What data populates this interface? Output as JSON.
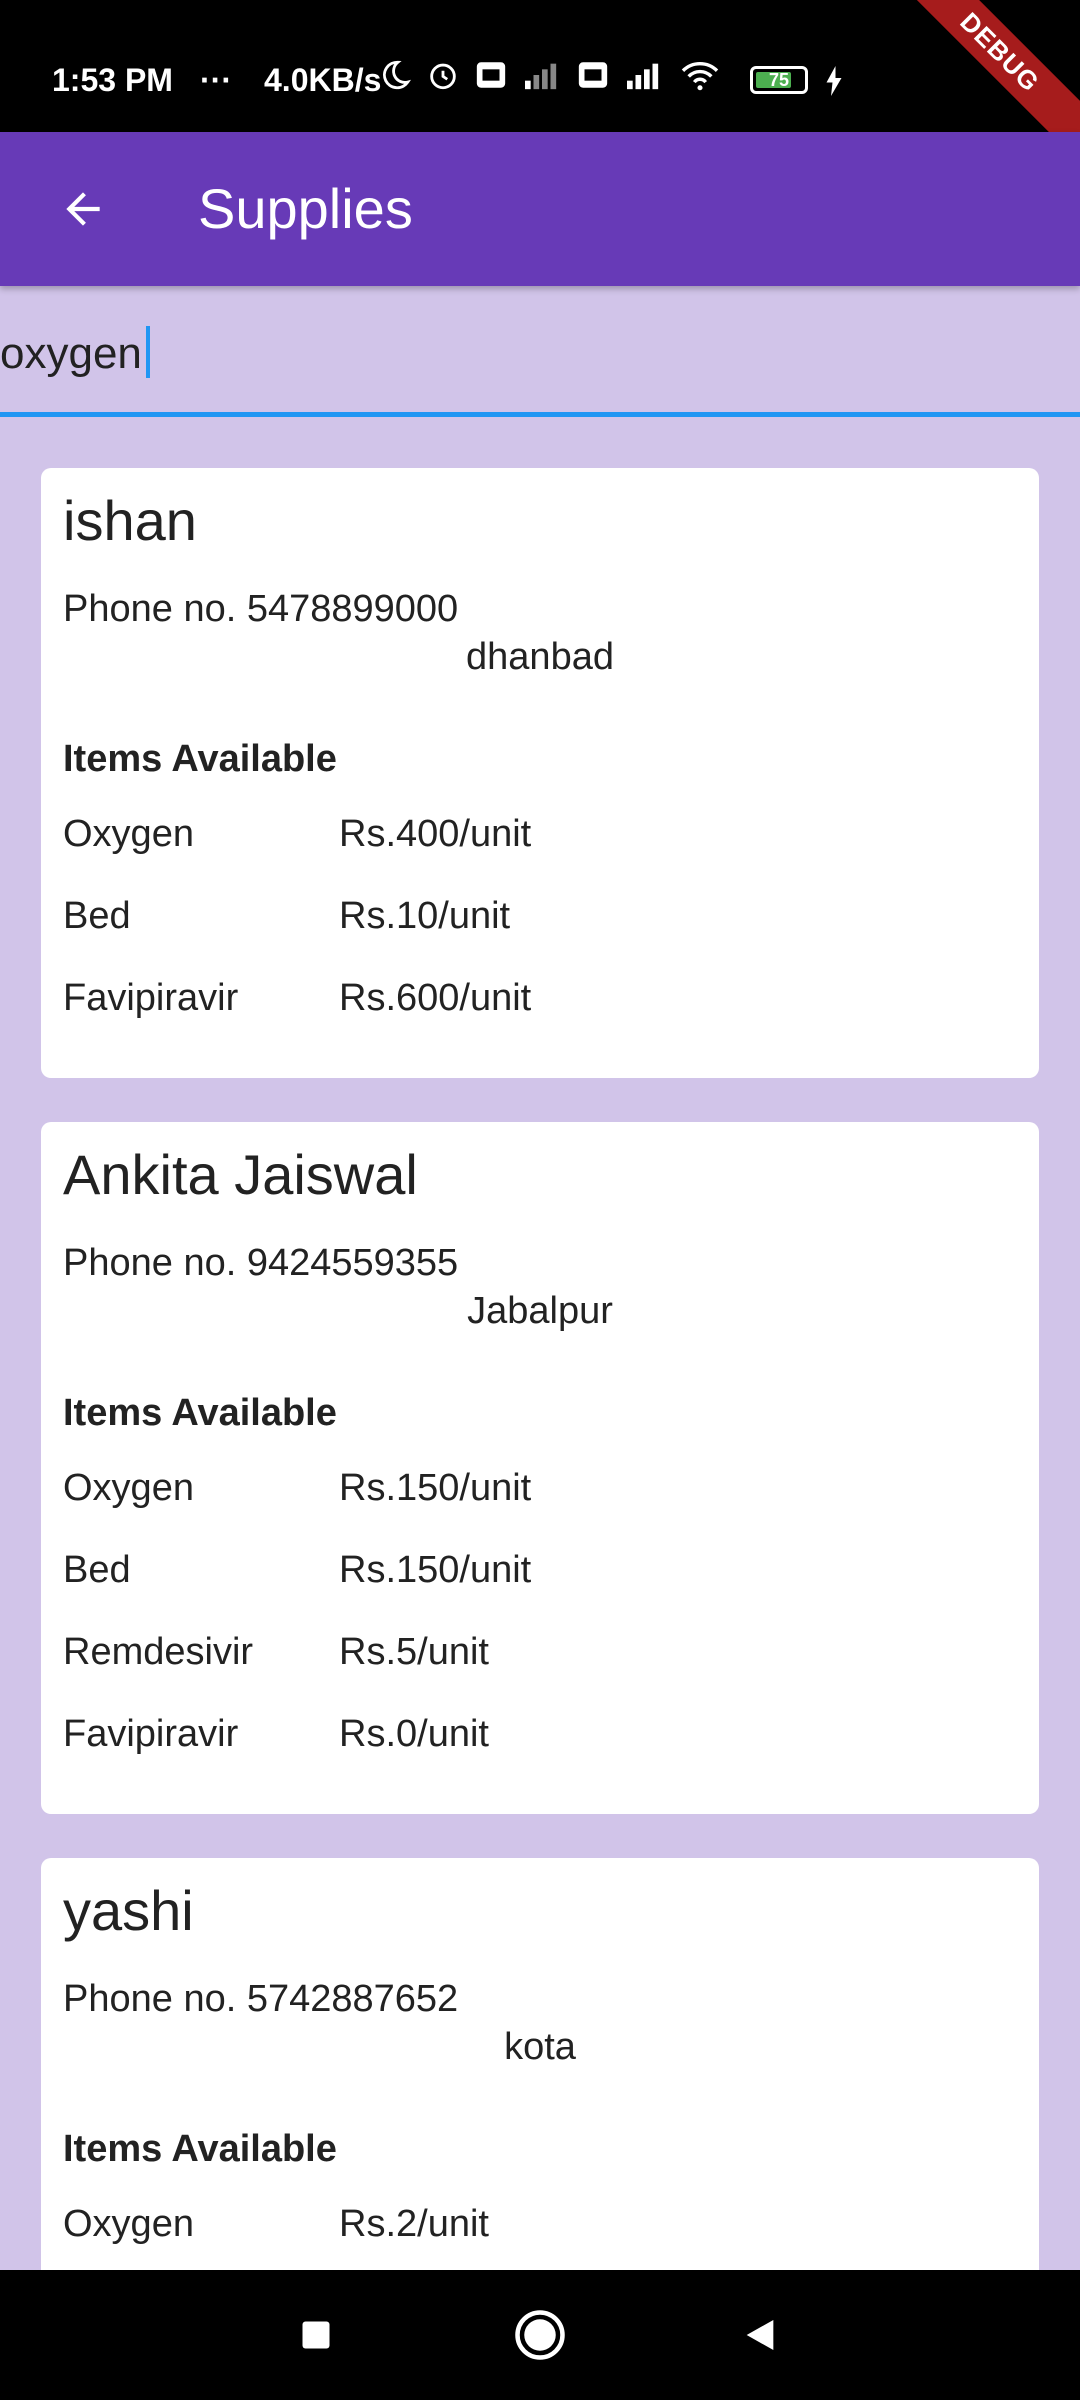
{
  "status_bar": {
    "time": "1:53 PM",
    "dots": "···",
    "speed": "4.0KB/s",
    "battery_level": "75",
    "battery_fraction": 0.75,
    "debug_label": "DEBUG"
  },
  "app_bar": {
    "title": "Supplies"
  },
  "search": {
    "value": "oxygen"
  },
  "cards": [
    {
      "name": "ishan",
      "phone": "Phone no. 5478899000",
      "city": "dhanbad",
      "items_heading": "Items Available",
      "items": [
        {
          "name": "Oxygen",
          "price": "Rs.400/unit"
        },
        {
          "name": "Bed",
          "price": "Rs.10/unit"
        },
        {
          "name": "Favipiravir",
          "price": "Rs.600/unit"
        }
      ]
    },
    {
      "name": "Ankita Jaiswal",
      "phone": "Phone no. 9424559355",
      "city": "Jabalpur",
      "items_heading": "Items Available",
      "items": [
        {
          "name": "Oxygen",
          "price": "Rs.150/unit"
        },
        {
          "name": "Bed",
          "price": "Rs.150/unit"
        },
        {
          "name": "Remdesivir",
          "price": "Rs.5/unit"
        },
        {
          "name": "Favipiravir",
          "price": "Rs.0/unit"
        }
      ]
    },
    {
      "name": "yashi",
      "phone": "Phone no. 5742887652",
      "city": "kota",
      "items_heading": "Items Available",
      "items": [
        {
          "name": "Oxygen",
          "price": "Rs.2/unit"
        }
      ]
    }
  ],
  "icons": {
    "back": "arrow-left-icon",
    "nav_recents": "square-icon",
    "nav_home": "circle-icon",
    "nav_back": "triangle-back-icon"
  },
  "colors": {
    "app_bar": "#673ab7",
    "background": "#d1c4e9",
    "search_accent": "#2196f3",
    "debug_ribbon": "#a61c1c"
  }
}
